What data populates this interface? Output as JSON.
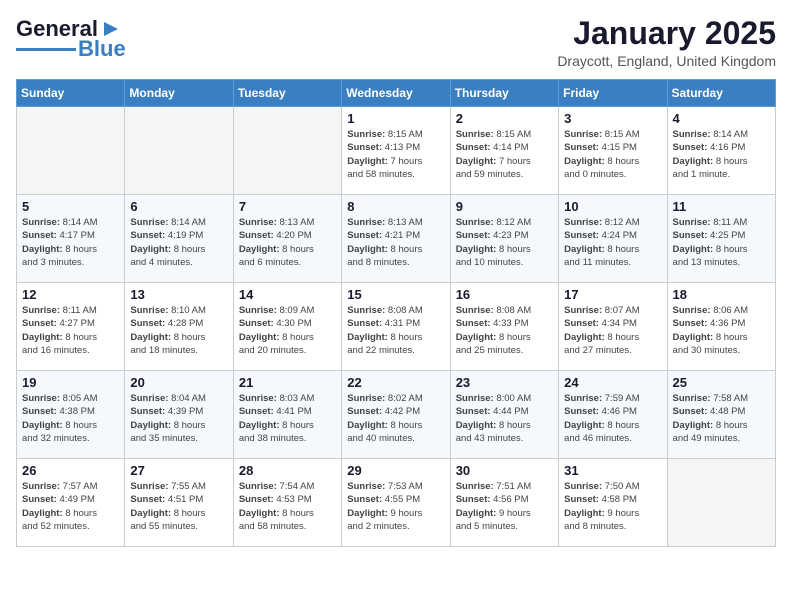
{
  "header": {
    "logo_general": "General",
    "logo_blue": "Blue",
    "month_title": "January 2025",
    "location": "Draycott, England, United Kingdom"
  },
  "days_of_week": [
    "Sunday",
    "Monday",
    "Tuesday",
    "Wednesday",
    "Thursday",
    "Friday",
    "Saturday"
  ],
  "weeks": [
    [
      {
        "day": "",
        "info": ""
      },
      {
        "day": "",
        "info": ""
      },
      {
        "day": "",
        "info": ""
      },
      {
        "day": "1",
        "info": "Sunrise: 8:15 AM\nSunset: 4:13 PM\nDaylight: 7 hours\nand 58 minutes."
      },
      {
        "day": "2",
        "info": "Sunrise: 8:15 AM\nSunset: 4:14 PM\nDaylight: 7 hours\nand 59 minutes."
      },
      {
        "day": "3",
        "info": "Sunrise: 8:15 AM\nSunset: 4:15 PM\nDaylight: 8 hours\nand 0 minutes."
      },
      {
        "day": "4",
        "info": "Sunrise: 8:14 AM\nSunset: 4:16 PM\nDaylight: 8 hours\nand 1 minute."
      }
    ],
    [
      {
        "day": "5",
        "info": "Sunrise: 8:14 AM\nSunset: 4:17 PM\nDaylight: 8 hours\nand 3 minutes."
      },
      {
        "day": "6",
        "info": "Sunrise: 8:14 AM\nSunset: 4:19 PM\nDaylight: 8 hours\nand 4 minutes."
      },
      {
        "day": "7",
        "info": "Sunrise: 8:13 AM\nSunset: 4:20 PM\nDaylight: 8 hours\nand 6 minutes."
      },
      {
        "day": "8",
        "info": "Sunrise: 8:13 AM\nSunset: 4:21 PM\nDaylight: 8 hours\nand 8 minutes."
      },
      {
        "day": "9",
        "info": "Sunrise: 8:12 AM\nSunset: 4:23 PM\nDaylight: 8 hours\nand 10 minutes."
      },
      {
        "day": "10",
        "info": "Sunrise: 8:12 AM\nSunset: 4:24 PM\nDaylight: 8 hours\nand 11 minutes."
      },
      {
        "day": "11",
        "info": "Sunrise: 8:11 AM\nSunset: 4:25 PM\nDaylight: 8 hours\nand 13 minutes."
      }
    ],
    [
      {
        "day": "12",
        "info": "Sunrise: 8:11 AM\nSunset: 4:27 PM\nDaylight: 8 hours\nand 16 minutes."
      },
      {
        "day": "13",
        "info": "Sunrise: 8:10 AM\nSunset: 4:28 PM\nDaylight: 8 hours\nand 18 minutes."
      },
      {
        "day": "14",
        "info": "Sunrise: 8:09 AM\nSunset: 4:30 PM\nDaylight: 8 hours\nand 20 minutes."
      },
      {
        "day": "15",
        "info": "Sunrise: 8:08 AM\nSunset: 4:31 PM\nDaylight: 8 hours\nand 22 minutes."
      },
      {
        "day": "16",
        "info": "Sunrise: 8:08 AM\nSunset: 4:33 PM\nDaylight: 8 hours\nand 25 minutes."
      },
      {
        "day": "17",
        "info": "Sunrise: 8:07 AM\nSunset: 4:34 PM\nDaylight: 8 hours\nand 27 minutes."
      },
      {
        "day": "18",
        "info": "Sunrise: 8:06 AM\nSunset: 4:36 PM\nDaylight: 8 hours\nand 30 minutes."
      }
    ],
    [
      {
        "day": "19",
        "info": "Sunrise: 8:05 AM\nSunset: 4:38 PM\nDaylight: 8 hours\nand 32 minutes."
      },
      {
        "day": "20",
        "info": "Sunrise: 8:04 AM\nSunset: 4:39 PM\nDaylight: 8 hours\nand 35 minutes."
      },
      {
        "day": "21",
        "info": "Sunrise: 8:03 AM\nSunset: 4:41 PM\nDaylight: 8 hours\nand 38 minutes."
      },
      {
        "day": "22",
        "info": "Sunrise: 8:02 AM\nSunset: 4:42 PM\nDaylight: 8 hours\nand 40 minutes."
      },
      {
        "day": "23",
        "info": "Sunrise: 8:00 AM\nSunset: 4:44 PM\nDaylight: 8 hours\nand 43 minutes."
      },
      {
        "day": "24",
        "info": "Sunrise: 7:59 AM\nSunset: 4:46 PM\nDaylight: 8 hours\nand 46 minutes."
      },
      {
        "day": "25",
        "info": "Sunrise: 7:58 AM\nSunset: 4:48 PM\nDaylight: 8 hours\nand 49 minutes."
      }
    ],
    [
      {
        "day": "26",
        "info": "Sunrise: 7:57 AM\nSunset: 4:49 PM\nDaylight: 8 hours\nand 52 minutes."
      },
      {
        "day": "27",
        "info": "Sunrise: 7:55 AM\nSunset: 4:51 PM\nDaylight: 8 hours\nand 55 minutes."
      },
      {
        "day": "28",
        "info": "Sunrise: 7:54 AM\nSunset: 4:53 PM\nDaylight: 8 hours\nand 58 minutes."
      },
      {
        "day": "29",
        "info": "Sunrise: 7:53 AM\nSunset: 4:55 PM\nDaylight: 9 hours\nand 2 minutes."
      },
      {
        "day": "30",
        "info": "Sunrise: 7:51 AM\nSunset: 4:56 PM\nDaylight: 9 hours\nand 5 minutes."
      },
      {
        "day": "31",
        "info": "Sunrise: 7:50 AM\nSunset: 4:58 PM\nDaylight: 9 hours\nand 8 minutes."
      },
      {
        "day": "",
        "info": ""
      }
    ]
  ]
}
